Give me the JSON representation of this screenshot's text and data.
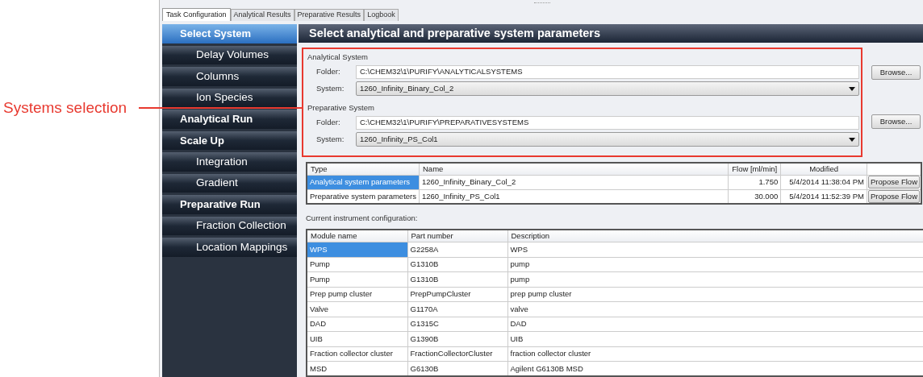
{
  "annotation": {
    "label": "Systems selection"
  },
  "tabs": [
    {
      "label": "Task Configuration",
      "selected": true
    },
    {
      "label": "Analytical Results",
      "selected": false
    },
    {
      "label": "Preparative Results",
      "selected": false
    },
    {
      "label": "Logbook",
      "selected": false
    }
  ],
  "sidebar": {
    "items": [
      {
        "label": "Select System",
        "kind": "section",
        "selected": true
      },
      {
        "label": "Delay Volumes",
        "kind": "sub",
        "selected": false
      },
      {
        "label": "Columns",
        "kind": "sub",
        "selected": false
      },
      {
        "label": "Ion Species",
        "kind": "sub",
        "selected": false
      },
      {
        "label": "Analytical Run",
        "kind": "section",
        "selected": false
      },
      {
        "label": "Scale Up",
        "kind": "section",
        "selected": false
      },
      {
        "label": "Integration",
        "kind": "sub",
        "selected": false
      },
      {
        "label": "Gradient",
        "kind": "sub",
        "selected": false
      },
      {
        "label": "Preparative Run",
        "kind": "section",
        "selected": false
      },
      {
        "label": "Fraction Collection",
        "kind": "sub",
        "selected": false
      },
      {
        "label": "Location Mappings",
        "kind": "sub",
        "selected": false
      }
    ]
  },
  "header": {
    "title": "Select analytical and preparative system parameters"
  },
  "systems": [
    {
      "title": "Analytical System",
      "folder_label": "Folder:",
      "folder": "C:\\CHEM32\\1\\PURIFY\\ANALYTICALSYSTEMS",
      "system_label": "System:",
      "system": "1260_Infinity_Binary_Col_2",
      "browse": "Browse..."
    },
    {
      "title": "Preparative System",
      "folder_label": "Folder:",
      "folder": "C:\\CHEM32\\1\\PURIFY\\PREPARATIVESYSTEMS",
      "system_label": "System:",
      "system": "1260_Infinity_PS_Col1",
      "browse": "Browse..."
    }
  ],
  "parameters_table": {
    "columns": [
      "Type",
      "Name",
      "Flow [ml/min]",
      "Modified"
    ],
    "rows": [
      {
        "type": "Analytical system parameters",
        "name": "1260_Infinity_Binary_Col_2",
        "flow": "1.750",
        "modified": "5/4/2014 11:38:04 PM",
        "button": "Propose Flow",
        "selected": true
      },
      {
        "type": "Preparative system parameters",
        "name": "1260_Infinity_PS_Col1",
        "flow": "30.000",
        "modified": "5/4/2014 11:52:39 PM",
        "button": "Propose Flow",
        "selected": false
      }
    ]
  },
  "config_label": "Current instrument configuration:",
  "config_table": {
    "columns": [
      "Module name",
      "Part number",
      "Description"
    ],
    "rows": [
      {
        "cells": [
          "WPS",
          "G2258A",
          "WPS"
        ],
        "selected": true
      },
      {
        "cells": [
          "Pump",
          "G1310B",
          "pump"
        ],
        "selected": false
      },
      {
        "cells": [
          "Pump",
          "G1310B",
          "pump"
        ],
        "selected": false
      },
      {
        "cells": [
          "Prep pump cluster",
          "PrepPumpCluster",
          "prep pump cluster"
        ],
        "selected": false
      },
      {
        "cells": [
          "Valve",
          "G1170A",
          "valve"
        ],
        "selected": false
      },
      {
        "cells": [
          "DAD",
          "G1315C",
          "DAD"
        ],
        "selected": false
      },
      {
        "cells": [
          "UIB",
          "G1390B",
          "UIB"
        ],
        "selected": false
      },
      {
        "cells": [
          "Fraction collector cluster",
          "FractionCollectorCluster",
          "fraction collector cluster"
        ],
        "selected": false
      },
      {
        "cells": [
          "MSD",
          "G6130B",
          "Agilent G6130B MSD"
        ],
        "selected": false
      }
    ]
  }
}
